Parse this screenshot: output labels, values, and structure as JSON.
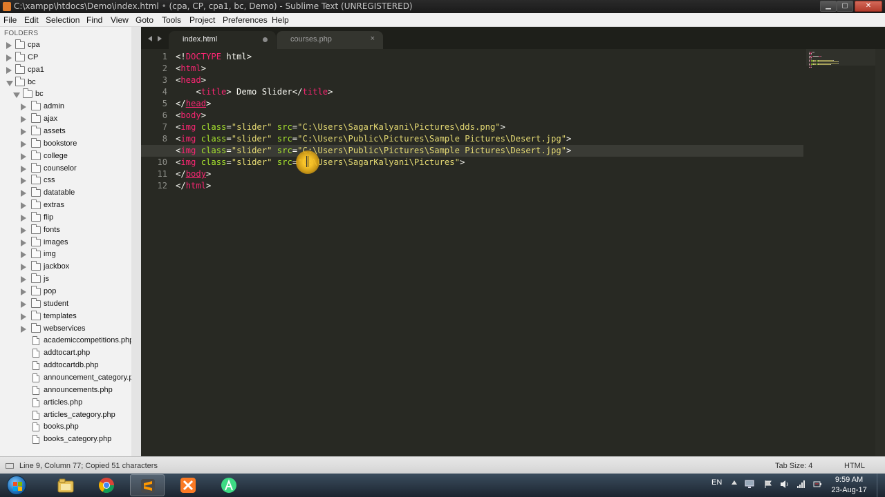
{
  "window": {
    "title_path": "C:\\xampp\\htdocs\\Demo\\index.html",
    "title_dot": "•",
    "title_rest": "(cpa, CP, cpa1, bc, Demo) - Sublime Text (UNREGISTERED)",
    "min_glyph": "▁",
    "max_glyph": "▢",
    "close_glyph": "✕"
  },
  "menu": [
    "File",
    "Edit",
    "Selection",
    "Find",
    "View",
    "Goto",
    "Tools",
    "Project",
    "Preferences",
    "Help"
  ],
  "sidebar": {
    "header": "FOLDERS",
    "items": [
      {
        "label": "cpa",
        "type": "folder",
        "state": "closed",
        "level": 0
      },
      {
        "label": "CP",
        "type": "folder",
        "state": "closed",
        "level": 0
      },
      {
        "label": "cpa1",
        "type": "folder",
        "state": "closed",
        "level": 0
      },
      {
        "label": "bc",
        "type": "folder",
        "state": "open",
        "level": 0
      },
      {
        "label": "bc",
        "type": "folder",
        "state": "open",
        "level": 1
      },
      {
        "label": "admin",
        "type": "folder",
        "state": "closed",
        "level": 2
      },
      {
        "label": "ajax",
        "type": "folder",
        "state": "closed",
        "level": 2
      },
      {
        "label": "assets",
        "type": "folder",
        "state": "closed",
        "level": 2
      },
      {
        "label": "bookstore",
        "type": "folder",
        "state": "closed",
        "level": 2
      },
      {
        "label": "college",
        "type": "folder",
        "state": "closed",
        "level": 2
      },
      {
        "label": "counselor",
        "type": "folder",
        "state": "closed",
        "level": 2
      },
      {
        "label": "css",
        "type": "folder",
        "state": "closed",
        "level": 2
      },
      {
        "label": "datatable",
        "type": "folder",
        "state": "closed",
        "level": 2
      },
      {
        "label": "extras",
        "type": "folder",
        "state": "closed",
        "level": 2
      },
      {
        "label": "flip",
        "type": "folder",
        "state": "closed",
        "level": 2
      },
      {
        "label": "fonts",
        "type": "folder",
        "state": "closed",
        "level": 2
      },
      {
        "label": "images",
        "type": "folder",
        "state": "closed",
        "level": 2
      },
      {
        "label": "img",
        "type": "folder",
        "state": "closed",
        "level": 2
      },
      {
        "label": "jackbox",
        "type": "folder",
        "state": "closed",
        "level": 2
      },
      {
        "label": "js",
        "type": "folder",
        "state": "closed",
        "level": 2
      },
      {
        "label": "pop",
        "type": "folder",
        "state": "closed",
        "level": 2
      },
      {
        "label": "student",
        "type": "folder",
        "state": "closed",
        "level": 2
      },
      {
        "label": "templates",
        "type": "folder",
        "state": "closed",
        "level": 2
      },
      {
        "label": "webservices",
        "type": "folder",
        "state": "closed",
        "level": 2
      },
      {
        "label": "academiccompetitions.php",
        "type": "file",
        "level": 2
      },
      {
        "label": "addtocart.php",
        "type": "file",
        "level": 2
      },
      {
        "label": "addtocartdb.php",
        "type": "file",
        "level": 2
      },
      {
        "label": "announcement_category.php",
        "type": "file",
        "level": 2
      },
      {
        "label": "announcements.php",
        "type": "file",
        "level": 2
      },
      {
        "label": "articles.php",
        "type": "file",
        "level": 2
      },
      {
        "label": "articles_category.php",
        "type": "file",
        "level": 2
      },
      {
        "label": "books.php",
        "type": "file",
        "level": 2
      },
      {
        "label": "books_category.php",
        "type": "file",
        "level": 2
      }
    ]
  },
  "tabs": [
    {
      "label": "index.html",
      "active": true,
      "dirty": true
    },
    {
      "label": "courses.php",
      "active": false,
      "dirty": false,
      "close_glyph": "×"
    }
  ],
  "editor": {
    "active_line": 9,
    "lines": [
      [
        [
          "<!",
          "p"
        ],
        [
          "DOCTYPE",
          "t"
        ],
        [
          " html>",
          "p"
        ]
      ],
      [
        [
          "<",
          "p"
        ],
        [
          "html",
          "t"
        ],
        [
          ">",
          "p"
        ]
      ],
      [
        [
          "<",
          "p"
        ],
        [
          "head",
          "t"
        ],
        [
          ">",
          "p"
        ]
      ],
      [
        [
          "    <",
          "p"
        ],
        [
          "title",
          "t"
        ],
        [
          "> Demo Slider</",
          "p"
        ],
        [
          "title",
          "t"
        ],
        [
          ">",
          "p"
        ]
      ],
      [
        [
          "</",
          "p"
        ],
        [
          "head",
          "t"
        ],
        [
          ">",
          "p"
        ]
      ],
      [
        [
          "<",
          "p"
        ],
        [
          "body",
          "t"
        ],
        [
          ">",
          "p"
        ]
      ],
      [
        [
          "<",
          "p"
        ],
        [
          "img",
          "t"
        ],
        [
          " ",
          "p"
        ],
        [
          "class",
          "a"
        ],
        [
          "=",
          "p"
        ],
        [
          "\"slider\"",
          "s"
        ],
        [
          " ",
          "p"
        ],
        [
          "src",
          "a"
        ],
        [
          "=",
          "p"
        ],
        [
          "\"C:\\Users\\SagarKalyani\\Pictures\\dds.png\"",
          "s"
        ],
        [
          ">",
          "p"
        ]
      ],
      [
        [
          "<",
          "p"
        ],
        [
          "img",
          "t"
        ],
        [
          " ",
          "p"
        ],
        [
          "class",
          "a"
        ],
        [
          "=",
          "p"
        ],
        [
          "\"slider\"",
          "s"
        ],
        [
          " ",
          "p"
        ],
        [
          "src",
          "a"
        ],
        [
          "=",
          "p"
        ],
        [
          "\"C:\\Users\\Public\\Pictures\\Sample Pictures\\Desert.jpg\"",
          "s"
        ],
        [
          ">",
          "p"
        ]
      ],
      [
        [
          "<",
          "p"
        ],
        [
          "img",
          "t"
        ],
        [
          " ",
          "p"
        ],
        [
          "class",
          "a"
        ],
        [
          "=",
          "p"
        ],
        [
          "\"slider\"",
          "s"
        ],
        [
          " ",
          "p"
        ],
        [
          "src",
          "a"
        ],
        [
          "=",
          "p"
        ],
        [
          "\"C:\\Users\\Public\\Pictures\\Sample Pictures\\Desert.jpg\"",
          "s"
        ],
        [
          ">",
          "p"
        ]
      ],
      [
        [
          "<",
          "p"
        ],
        [
          "img",
          "t"
        ],
        [
          " ",
          "p"
        ],
        [
          "class",
          "a"
        ],
        [
          "=",
          "p"
        ],
        [
          "\"slider\"",
          "s"
        ],
        [
          " ",
          "p"
        ],
        [
          "src",
          "a"
        ],
        [
          "=",
          "p"
        ],
        [
          "\"C:\\Users\\SagarKalyani\\Pictures\"",
          "s"
        ],
        [
          ">",
          "p"
        ]
      ],
      [
        [
          "</",
          "p"
        ],
        [
          "body",
          "t"
        ],
        [
          ">",
          "p"
        ]
      ],
      [
        [
          "</",
          "p"
        ],
        [
          "html",
          "t"
        ],
        [
          ">",
          "p"
        ]
      ]
    ]
  },
  "statusbar": {
    "text": "Line 9, Column 77; Copied 51 characters",
    "tab_size": "Tab Size: 4",
    "syntax": "HTML"
  },
  "taskbar": {
    "apps": [
      {
        "name": "explorer-icon",
        "active": false
      },
      {
        "name": "chrome-icon",
        "active": false
      },
      {
        "name": "sublime-text-icon",
        "active": true
      },
      {
        "name": "xampp-icon",
        "active": false
      },
      {
        "name": "android-studio-icon",
        "active": false
      }
    ],
    "lang": "EN",
    "time": "9:59 AM",
    "date": "23-Aug-17"
  },
  "colors": {
    "editor_bg": "#282923",
    "tag": "#f92672",
    "attr": "#a6e22e",
    "string": "#e6db74",
    "plain": "#f8f8f2"
  }
}
